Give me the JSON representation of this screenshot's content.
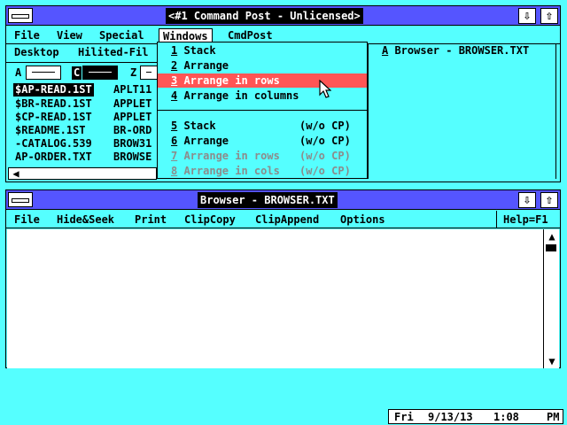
{
  "top_window": {
    "title": "<#1 Command Post - Unlicensed>",
    "menu": [
      "File",
      "View",
      "Special",
      "Windows",
      "CmdPost"
    ],
    "submenu": [
      "Desktop",
      "Hilited-Fil"
    ],
    "drives": [
      "A",
      "C",
      "Z"
    ],
    "files_col1": [
      "$AP-READ.1ST",
      "$BR-READ.1ST",
      "$CP-READ.1ST",
      "$README.1ST",
      "-CATALOG.539",
      "AP-ORDER.TXT"
    ],
    "files_col2": [
      "APLT11",
      "APPLET",
      "APPLET",
      "BR-ORD",
      "BROW31",
      "BROWSE"
    ],
    "windows_list_item": "A  Browser - BROWSER.TXT"
  },
  "windows_menu": {
    "items": [
      {
        "num": "1",
        "label": " Stack",
        "suffix": ""
      },
      {
        "num": "2",
        "label": " Arrange",
        "suffix": ""
      },
      {
        "num": "3",
        "label": " Arrange in rows",
        "suffix": ""
      },
      {
        "num": "4",
        "label": " Arrange in columns",
        "suffix": ""
      },
      {
        "num": "5",
        "label": " Stack",
        "suffix": "(w/o CP)"
      },
      {
        "num": "6",
        "label": " Arrange",
        "suffix": "(w/o CP)"
      },
      {
        "num": "7",
        "label": " Arrange in rows",
        "suffix": "(w/o CP)"
      },
      {
        "num": "8",
        "label": " Arrange in cols",
        "suffix": "(w/o CP)"
      }
    ]
  },
  "browser_window": {
    "title": "Browser - BROWSER.TXT",
    "menu": [
      "File",
      "Hide&Seek",
      "Print",
      "ClipCopy",
      "ClipAppend",
      "Options"
    ],
    "help": "Help=F1"
  },
  "status": {
    "day": "Fri",
    "date": "9/13/13",
    "time": "1:08",
    "ampm": "PM"
  },
  "colors": {
    "desktop": "#55ffff",
    "titlebar": "#5555ff",
    "highlight": "#ff5555",
    "disabled": "#8c8c8c"
  }
}
